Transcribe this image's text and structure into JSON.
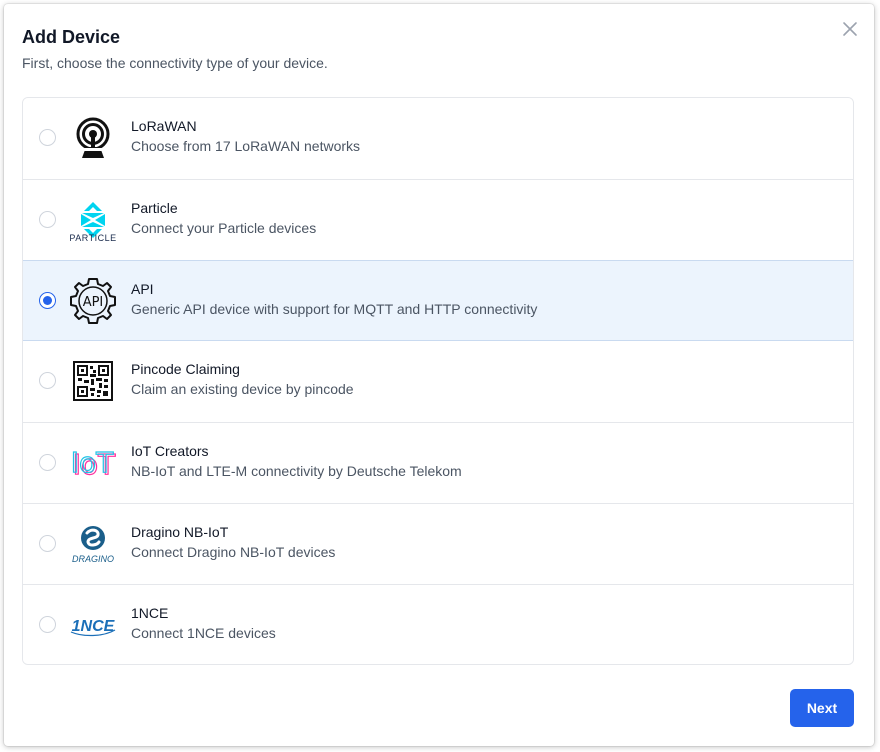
{
  "dialog": {
    "title": "Add Device",
    "subtitle": "First, choose the connectivity type of your device.",
    "close_icon": "close-icon",
    "next_label": "Next"
  },
  "options": [
    {
      "id": "lorawan",
      "title": "LoRaWAN",
      "description": "Choose from 17 LoRaWAN networks",
      "icon": "lorawan-antenna-icon",
      "selected": false
    },
    {
      "id": "particle",
      "title": "Particle",
      "description": "Connect your Particle devices",
      "icon": "particle-logo",
      "logo_text": "PARTICLE",
      "selected": false
    },
    {
      "id": "api",
      "title": "API",
      "description": "Generic API device with support for MQTT and HTTP connectivity",
      "icon": "api-gear-icon",
      "logo_text": "API",
      "selected": true
    },
    {
      "id": "pincode",
      "title": "Pincode Claiming",
      "description": "Claim an existing device by pincode",
      "icon": "qr-code-icon",
      "selected": false
    },
    {
      "id": "iot-creators",
      "title": "IoT Creators",
      "description": "NB-IoT and LTE-M connectivity by Deutsche Telekom",
      "icon": "iot-creators-logo",
      "logo_text": "IoT",
      "selected": false
    },
    {
      "id": "dragino",
      "title": "Dragino NB-IoT",
      "description": "Connect Dragino NB-IoT devices",
      "icon": "dragino-logo",
      "logo_text": "DRAGINO",
      "selected": false
    },
    {
      "id": "1nce",
      "title": "1NCE",
      "description": "Connect 1NCE devices",
      "icon": "1nce-logo",
      "logo_text": "1NCE",
      "selected": false
    }
  ],
  "colors": {
    "accent": "#2563eb",
    "selected_bg": "#ecf4fd",
    "particle": "#00d4f0",
    "dragino": "#1a5e8a",
    "1nce": "#1b6fb8"
  }
}
